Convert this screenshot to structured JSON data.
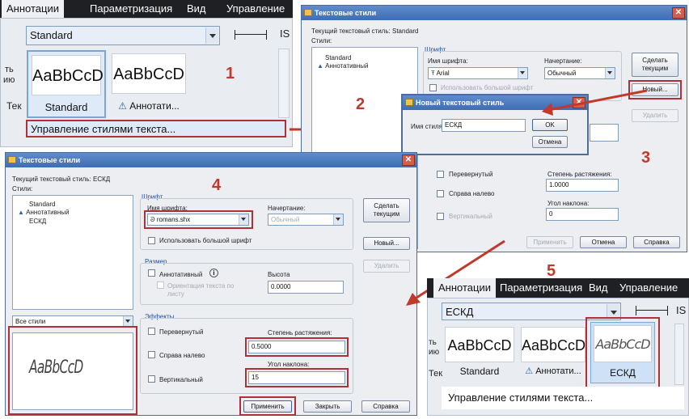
{
  "steps": [
    "1",
    "2",
    "3",
    "4",
    "5"
  ],
  "colors": {
    "accent_red": "#b0303a",
    "arrow": "#c0392b",
    "title_bar": "#4a79bf"
  },
  "ribbon1": {
    "tabs": [
      "Аннотации",
      "Параметризация",
      "Вид",
      "Управление"
    ],
    "style_combo": "Standard",
    "cut_label_a": "ть",
    "cut_label_b": "ию",
    "cut_label_c": "Тек",
    "cut_label_d": "IS",
    "sample_text": "AaBbCcD",
    "gallery": [
      "Standard",
      "Аннотати..."
    ],
    "menu_item": "Управление стилями текста..."
  },
  "dialog1": {
    "title": "Текстовые стили",
    "current_style_label": "Текущий текстовый стиль:",
    "current_style": "Standard",
    "styles_label": "Стили:",
    "styles": [
      "Standard",
      "Аннотативный"
    ],
    "font_group": "Шрифт",
    "font_name_label": "Имя шрифта:",
    "font_name": "Arial",
    "style_label": "Начертание:",
    "style_value": "Обычный",
    "bigfont": "Использовать большой шрифт",
    "make_current": "Сделать текущим",
    "new_btn": "Новый...",
    "delete_btn": "Удалить",
    "effects": {
      "upside": "Перевернутый",
      "backwards": "Справа налево",
      "vertical": "Вертикальный",
      "width_label": "Степень растяжения:",
      "width": "1.0000",
      "oblique_label": "Угол наклона:",
      "oblique": "0"
    },
    "apply": "Применить",
    "cancel": "Отмена",
    "help": "Справка"
  },
  "new_style_dialog": {
    "title": "Новый текстовый стиль",
    "name_label": "Имя стиля:",
    "name": "ЕСКД",
    "ok": "OK",
    "cancel": "Отмена"
  },
  "dialog2": {
    "title": "Текстовые стили",
    "current_style_label": "Текущий текстовый стиль:",
    "current_style": "ЕСКД",
    "styles_label": "Стили:",
    "styles": [
      "Standard",
      "Аннотативный",
      "ЕСКД"
    ],
    "font_group": "Шрифт",
    "font_name_label": "Имя шрифта:",
    "font_name": "romans.shx",
    "style_label": "Начертание:",
    "style_value": "Обычный",
    "bigfont": "Использовать большой шрифт",
    "make_current": "Сделать текущим",
    "new_btn": "Новый...",
    "delete_btn": "Удалить",
    "size_group": "Размер",
    "annotative": "Аннотативный",
    "orient": "Ориентация текста по листу",
    "height_label": "Высота",
    "height": "0.0000",
    "filter": "Все стили",
    "preview": "AaBbCcD",
    "effects_group": "Эффекты",
    "effects": {
      "upside": "Перевернутый",
      "backwards": "Справа налево",
      "vertical": "Вертикальный",
      "width_label": "Степень растяжения:",
      "width": "0.5000",
      "oblique_label": "Угол наклона:",
      "oblique": "15"
    },
    "apply": "Применить",
    "close": "Закрыть",
    "help": "Справка"
  },
  "ribbon2": {
    "tabs": [
      "Аннотации",
      "Параметризация",
      "Вид",
      "Управление"
    ],
    "style_combo": "ЕСКД",
    "cut_label_a": "ть",
    "cut_label_b": "ию",
    "cut_label_c": "Тек",
    "cut_label_d": "IS",
    "sample_text": "AaBbCcD",
    "gallery": [
      "Standard",
      "Аннотати...",
      "ЕСКД"
    ],
    "menu_item": "Управление стилями текста..."
  }
}
